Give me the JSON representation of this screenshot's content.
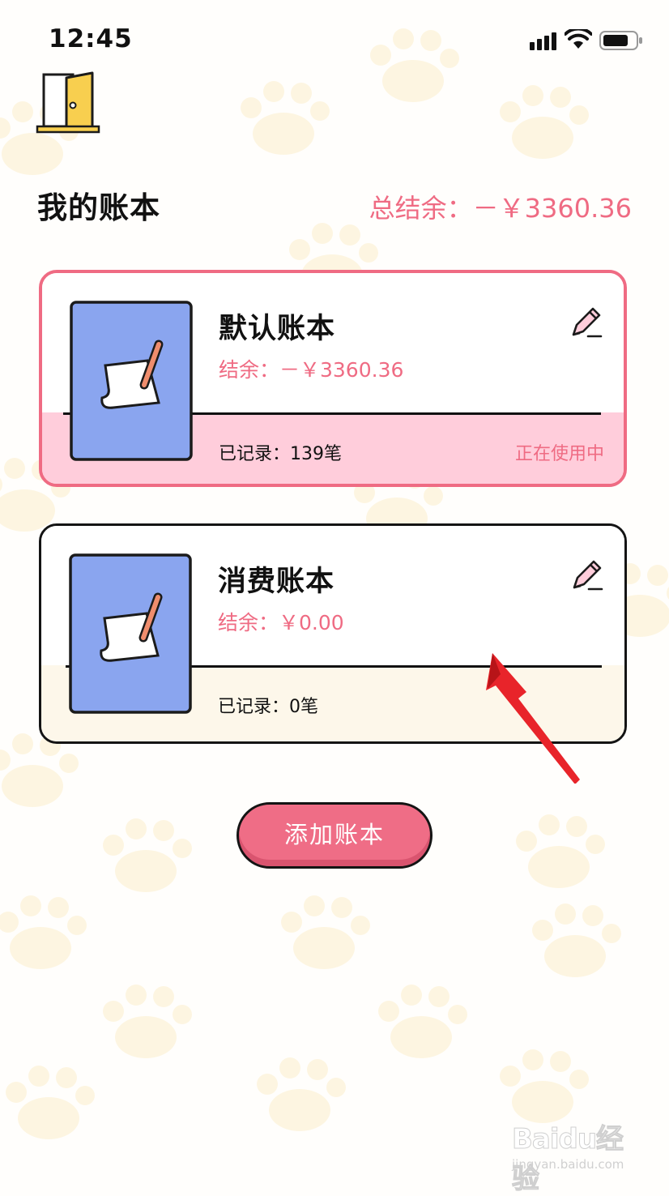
{
  "status_bar": {
    "time": "12:45"
  },
  "header": {
    "title": "我的账本",
    "total_balance": "总结余：－￥3360.36"
  },
  "books": [
    {
      "name": "默认账本",
      "balance": "结余：－￥3360.36",
      "records": "已记录：139笔",
      "status": "正在使用中"
    },
    {
      "name": "消费账本",
      "balance": "结余：￥0.00",
      "records": "已记录：0笔"
    }
  ],
  "add_button": {
    "label": "添加账本"
  },
  "watermark": {
    "logo_text": "Baidu经验",
    "url": "jingyan.baidu.com"
  },
  "colors": {
    "accent_pink": "#ef6b83",
    "active_card_bg": "#ffcddb",
    "inactive_card_bg": "#fdf7ea",
    "cover_blue": "#8aa5ef",
    "door_yellow": "#f8cf4f"
  },
  "icons": [
    "door-exit-icon",
    "pencil-edit-icon",
    "notebook-cover-icon",
    "signal-icon",
    "wifi-icon",
    "battery-icon",
    "red-arrow-annotation"
  ]
}
